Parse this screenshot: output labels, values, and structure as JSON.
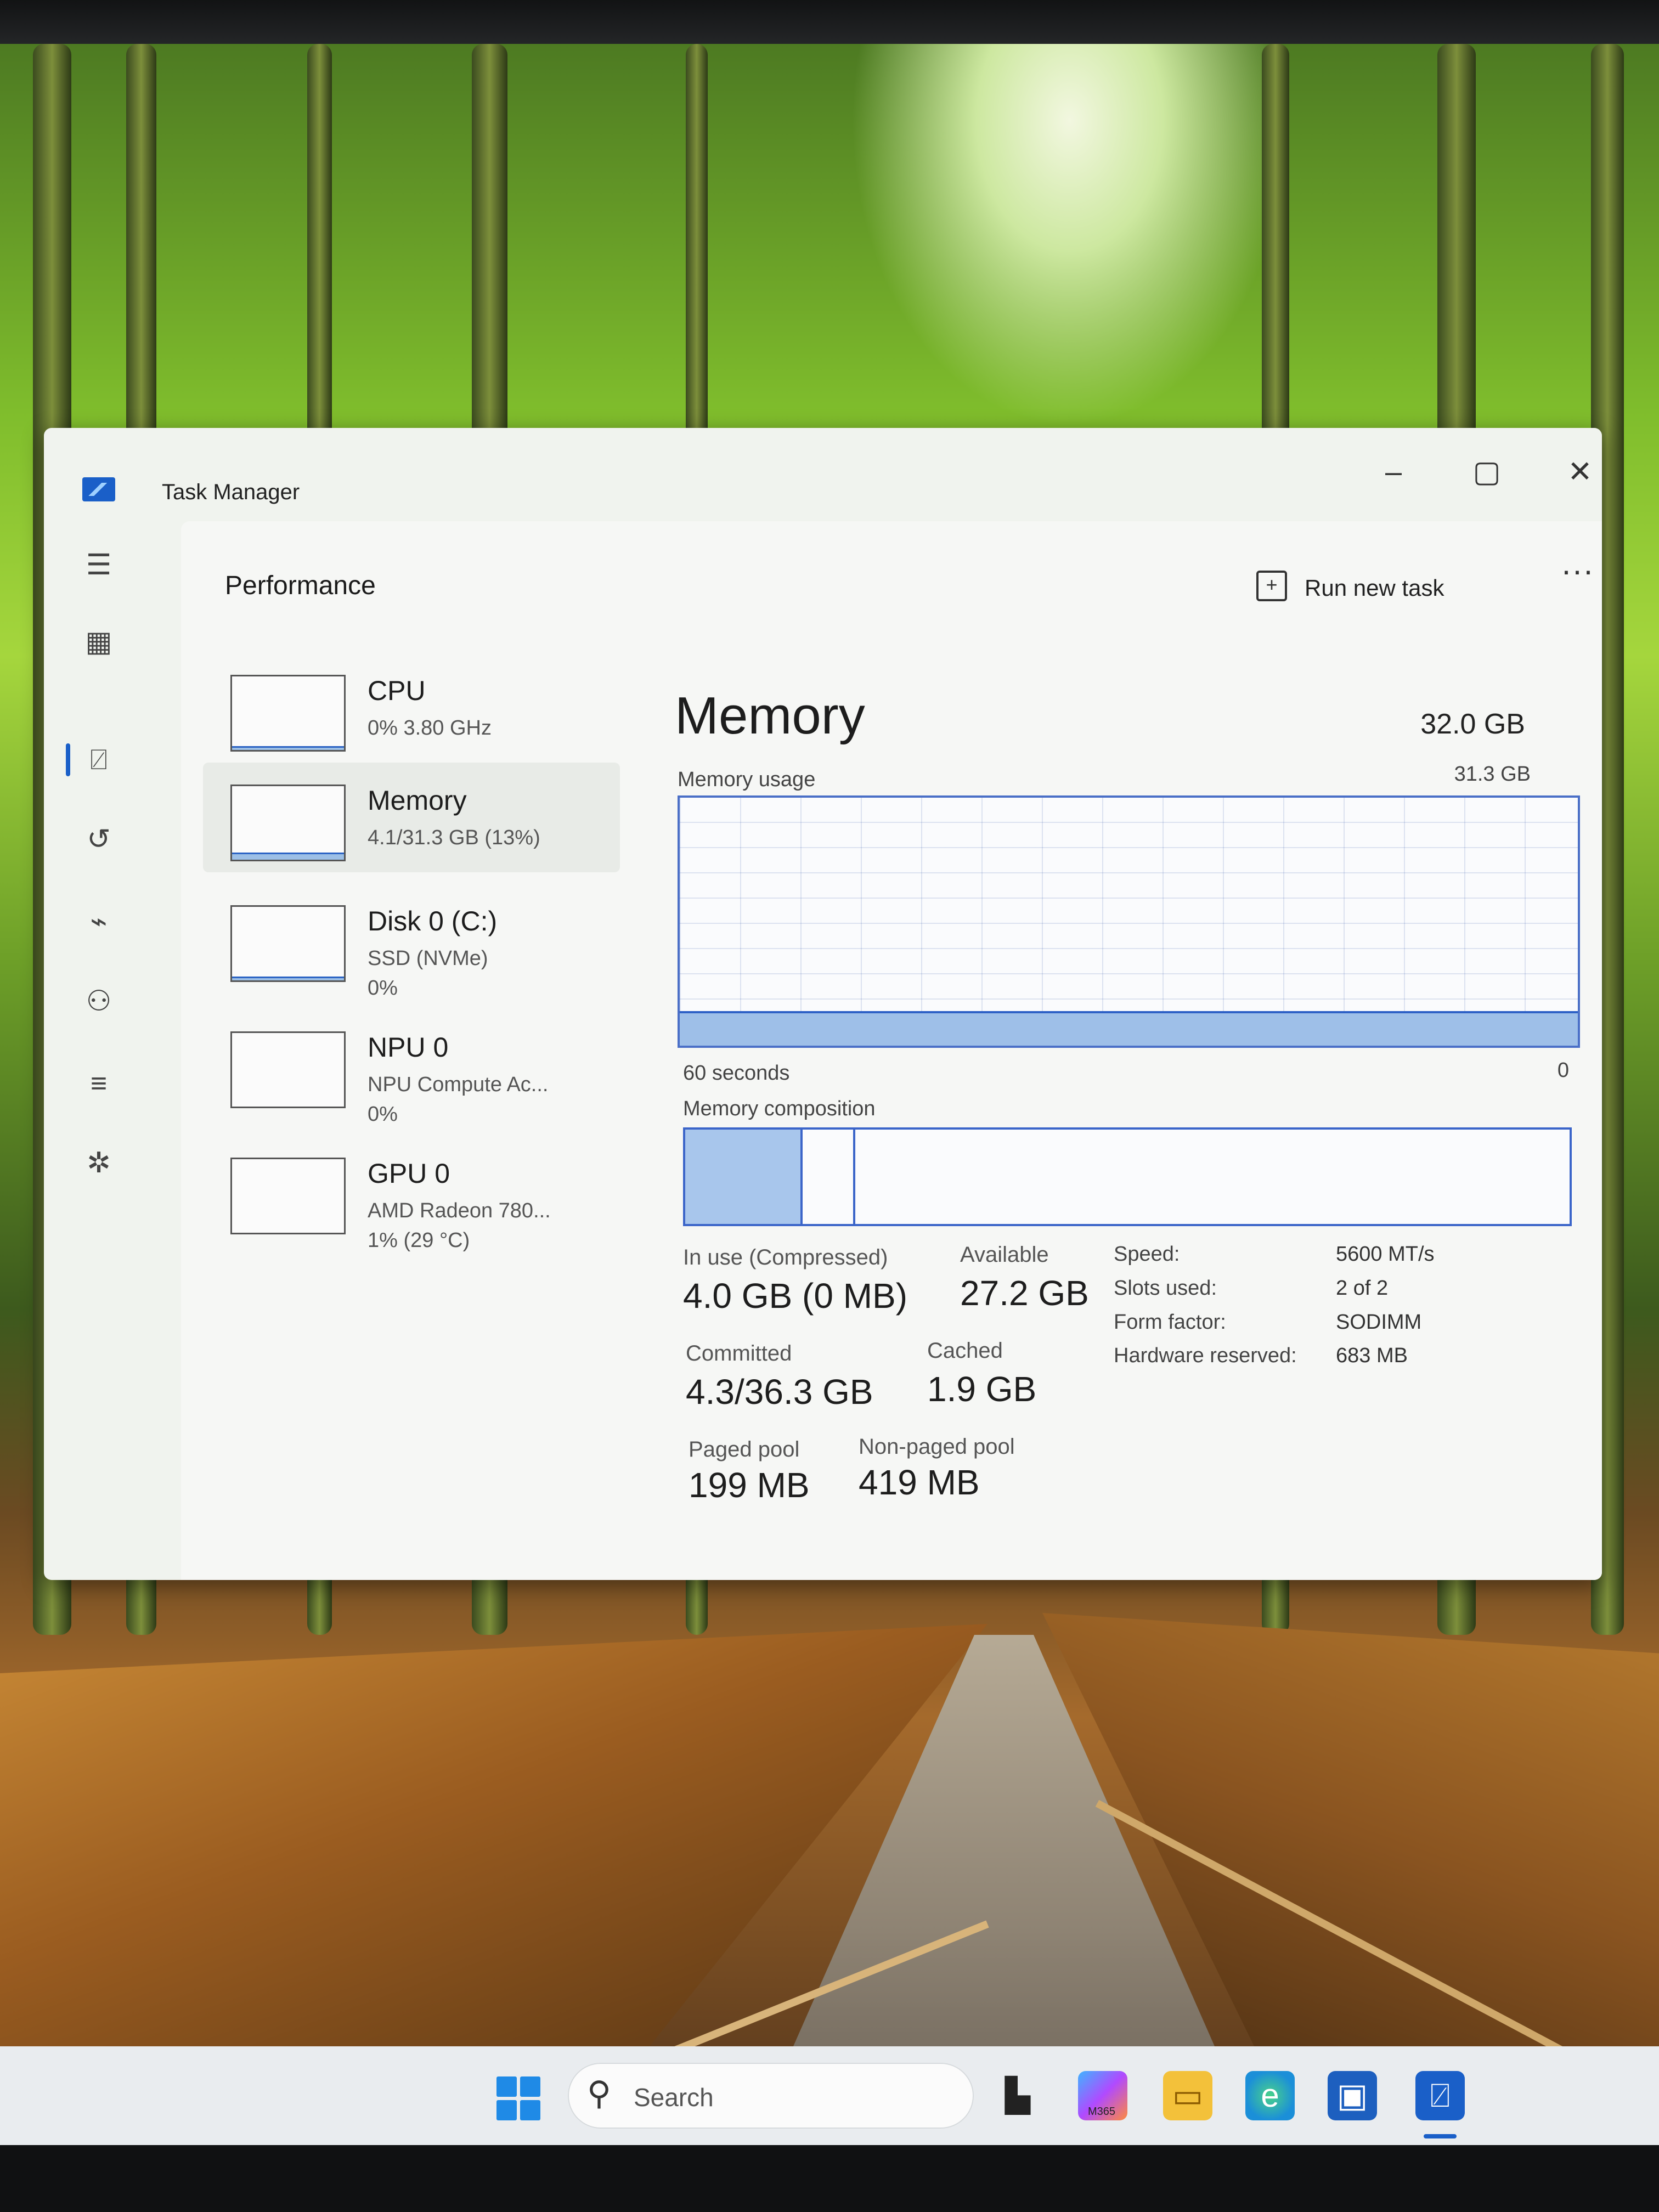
{
  "window": {
    "title": "Task Manager",
    "minimize": "–",
    "maximize": "▢",
    "close": "✕"
  },
  "header": {
    "page_title": "Performance",
    "run_new_task": "Run new task",
    "more": "···"
  },
  "devices": [
    {
      "name": "CPU",
      "line1": "0% 3.80 GHz",
      "line2": ""
    },
    {
      "name": "Memory",
      "line1": "4.1/31.3 GB (13%)",
      "line2": ""
    },
    {
      "name": "Disk 0 (C:)",
      "line1": "SSD (NVMe)",
      "line2": "0%"
    },
    {
      "name": "NPU 0",
      "line1": "NPU Compute Ac...",
      "line2": "0%"
    },
    {
      "name": "GPU 0",
      "line1": "AMD Radeon 780...",
      "line2": "1% (29 °C)"
    }
  ],
  "memory": {
    "title": "Memory",
    "total": "32.0 GB",
    "usage_label": "Memory usage",
    "usage_max": "31.3 GB",
    "axis_left": "60 seconds",
    "axis_right": "0",
    "usage_fraction": 0.13,
    "composition_label": "Memory composition",
    "composition": {
      "in_use_fraction": 0.13,
      "modified_end_fraction": 0.19
    },
    "stats": {
      "in_use_label": "In use (Compressed)",
      "in_use_value": "4.0 GB (0 MB)",
      "available_label": "Available",
      "available_value": "27.2 GB",
      "committed_label": "Committed",
      "committed_value": "4.3/36.3 GB",
      "cached_label": "Cached",
      "cached_value": "1.9 GB",
      "paged_label": "Paged pool",
      "paged_value": "199 MB",
      "nonpaged_label": "Non-paged pool",
      "nonpaged_value": "419 MB"
    },
    "specs": [
      {
        "label": "Speed:",
        "value": "5600 MT/s"
      },
      {
        "label": "Slots used:",
        "value": "2 of 2"
      },
      {
        "label": "Form factor:",
        "value": "SODIMM"
      },
      {
        "label": "Hardware reserved:",
        "value": "683 MB"
      }
    ]
  },
  "taskbar": {
    "search_placeholder": "Search",
    "m365_label": "M365"
  },
  "colors": {
    "accent": "#1a5fc8",
    "graph_fill": "#9ebfe8",
    "graph_line": "#2d60c6"
  }
}
